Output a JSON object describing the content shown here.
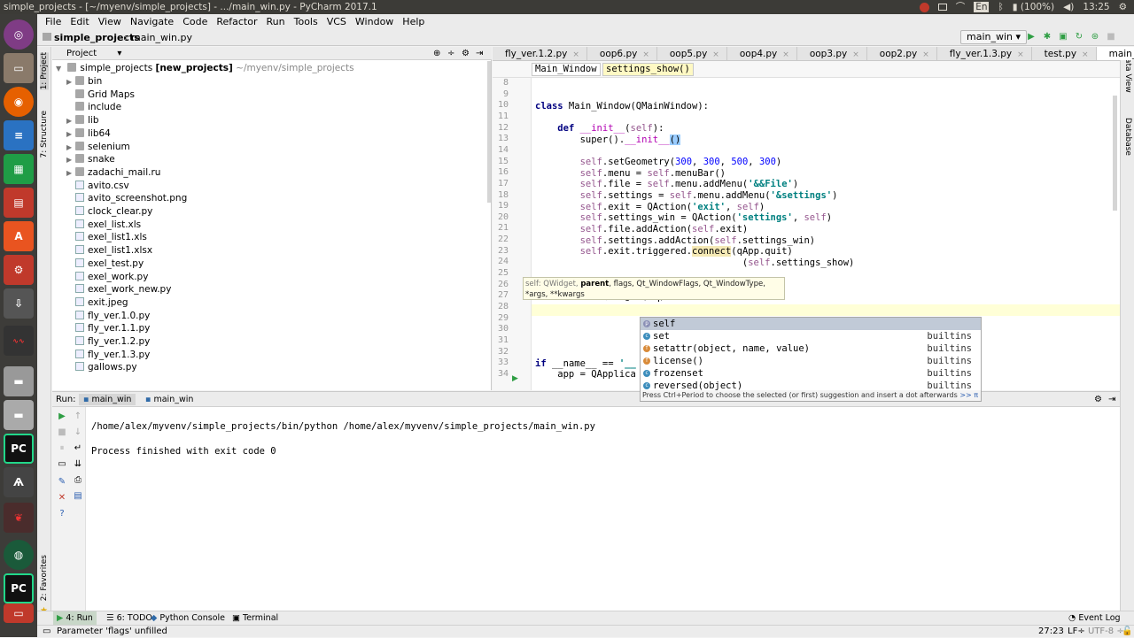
{
  "os": {
    "window_title": "simple_projects - [~/myenv/simple_projects] - .../main_win.py - PyCharm 2017.1",
    "tray": {
      "lang": "En",
      "battery": "(100%)",
      "clock": "13:25"
    }
  },
  "launcher": [
    "Ubuntu Dash",
    "Files",
    "Firefox",
    "LibreOffice Writer",
    "LibreOffice Calc",
    "LibreOffice Impress",
    "Ubuntu Software",
    "System Settings",
    "Software Updater",
    "System Monitor",
    "Disks",
    "Drive",
    "PyCharm",
    "Kdenlive",
    "Cherry",
    "Globe",
    "PyCharm 2",
    "Trash"
  ],
  "menu": [
    "File",
    "Edit",
    "View",
    "Navigate",
    "Code",
    "Refactor",
    "Run",
    "Tools",
    "VCS",
    "Window",
    "Help"
  ],
  "nav": {
    "project": "simple_projects",
    "file": "main_win.py",
    "run_config": "main_win"
  },
  "left_stripe": {
    "project": "1: Project",
    "structure": "7: Structure",
    "favorites": "2: Favorites"
  },
  "right_stripe": {
    "dataview": "Data View",
    "database": "Database"
  },
  "project_panel": {
    "header": "Project",
    "root": {
      "name": "simple_projects",
      "module": "[new_projects]",
      "path": "~/myenv/simple_projects"
    },
    "items": [
      {
        "name": "bin",
        "type": "folder",
        "expandable": true
      },
      {
        "name": "Grid Maps",
        "type": "folder",
        "expandable": false
      },
      {
        "name": "include",
        "type": "folder",
        "expandable": false
      },
      {
        "name": "lib",
        "type": "folder",
        "expandable": true
      },
      {
        "name": "lib64",
        "type": "folder",
        "expandable": true
      },
      {
        "name": "selenium",
        "type": "folder",
        "expandable": true
      },
      {
        "name": "snake",
        "type": "folder",
        "expandable": true
      },
      {
        "name": "zadachi_mail.ru",
        "type": "folder",
        "expandable": true
      },
      {
        "name": "avito.csv",
        "type": "file",
        "expandable": false
      },
      {
        "name": "avito_screenshot.png",
        "type": "file",
        "expandable": false
      },
      {
        "name": "clock_clear.py",
        "type": "file",
        "expandable": false
      },
      {
        "name": "exel_list.xls",
        "type": "file",
        "expandable": false
      },
      {
        "name": "exel_list1.xls",
        "type": "file",
        "expandable": false
      },
      {
        "name": "exel_list1.xlsx",
        "type": "file",
        "expandable": false
      },
      {
        "name": "exel_test.py",
        "type": "file",
        "expandable": false
      },
      {
        "name": "exel_work.py",
        "type": "file",
        "expandable": false
      },
      {
        "name": "exel_work_new.py",
        "type": "file",
        "expandable": false
      },
      {
        "name": "exit.jpeg",
        "type": "file",
        "expandable": false
      },
      {
        "name": "fly_ver.1.0.py",
        "type": "file",
        "expandable": false
      },
      {
        "name": "fly_ver.1.1.py",
        "type": "file",
        "expandable": false
      },
      {
        "name": "fly_ver.1.2.py",
        "type": "file",
        "expandable": false
      },
      {
        "name": "fly_ver.1.3.py",
        "type": "file",
        "expandable": false
      },
      {
        "name": "gallows.py",
        "type": "file",
        "expandable": false
      }
    ]
  },
  "editor": {
    "tabs": [
      "fly_ver.1.2.py",
      "oop6.py",
      "oop5.py",
      "oop4.py",
      "oop3.py",
      "oop2.py",
      "fly_ver.1.3.py",
      "test.py",
      "main_win.py"
    ],
    "active_tab": "main_win.py",
    "crumbs": [
      "Main_Window",
      "settings_show()"
    ],
    "line_numbers": [
      "8",
      "9",
      "10",
      "11",
      "12",
      "13",
      "14",
      "15",
      "16",
      "17",
      "18",
      "19",
      "20",
      "21",
      "22",
      "23",
      "24",
      "25",
      "26",
      "27",
      "28",
      "29",
      "30",
      "31",
      "32",
      "33",
      "34"
    ],
    "parameter_hint": {
      "line1_pre": "self: QWidget, ",
      "line1_bold": "parent",
      "line1_post": ", flags, Qt_WindowFlags, Qt_WindowType,",
      "line2": "*args, **kwargs"
    },
    "completion": {
      "items": [
        {
          "icon": "p",
          "name": "self",
          "source": ""
        },
        {
          "icon": "c",
          "name": "set",
          "source": "builtins"
        },
        {
          "icon": "f",
          "name": "setattr(object, name, value)",
          "source": "builtins"
        },
        {
          "icon": "f",
          "name": "license()",
          "source": "builtins"
        },
        {
          "icon": "c",
          "name": "frozenset",
          "source": "builtins"
        },
        {
          "icon": "c",
          "name": "reversed(object)",
          "source": "builtins"
        }
      ],
      "footer": "Press Ctrl+Period to choose the selected (or first) suggestion and insert a dot afterwards",
      "footer_link": ">> π"
    }
  },
  "run_panel": {
    "label": "Run:",
    "tabs": [
      "main_win",
      "main_win"
    ],
    "console": [
      "/home/alex/myvenv/simple_projects/bin/python /home/alex/myvenv/simple_projects/main_win.py",
      "",
      "Process finished with exit code 0"
    ]
  },
  "tool_windows": [
    "4: Run",
    "6: TODO",
    "Python Console",
    "Terminal",
    "Event Log"
  ],
  "status": {
    "message": "Parameter 'flags' unfilled",
    "position": "27:23",
    "line_sep": "LF÷",
    "encoding": "UTF-8 ÷"
  }
}
